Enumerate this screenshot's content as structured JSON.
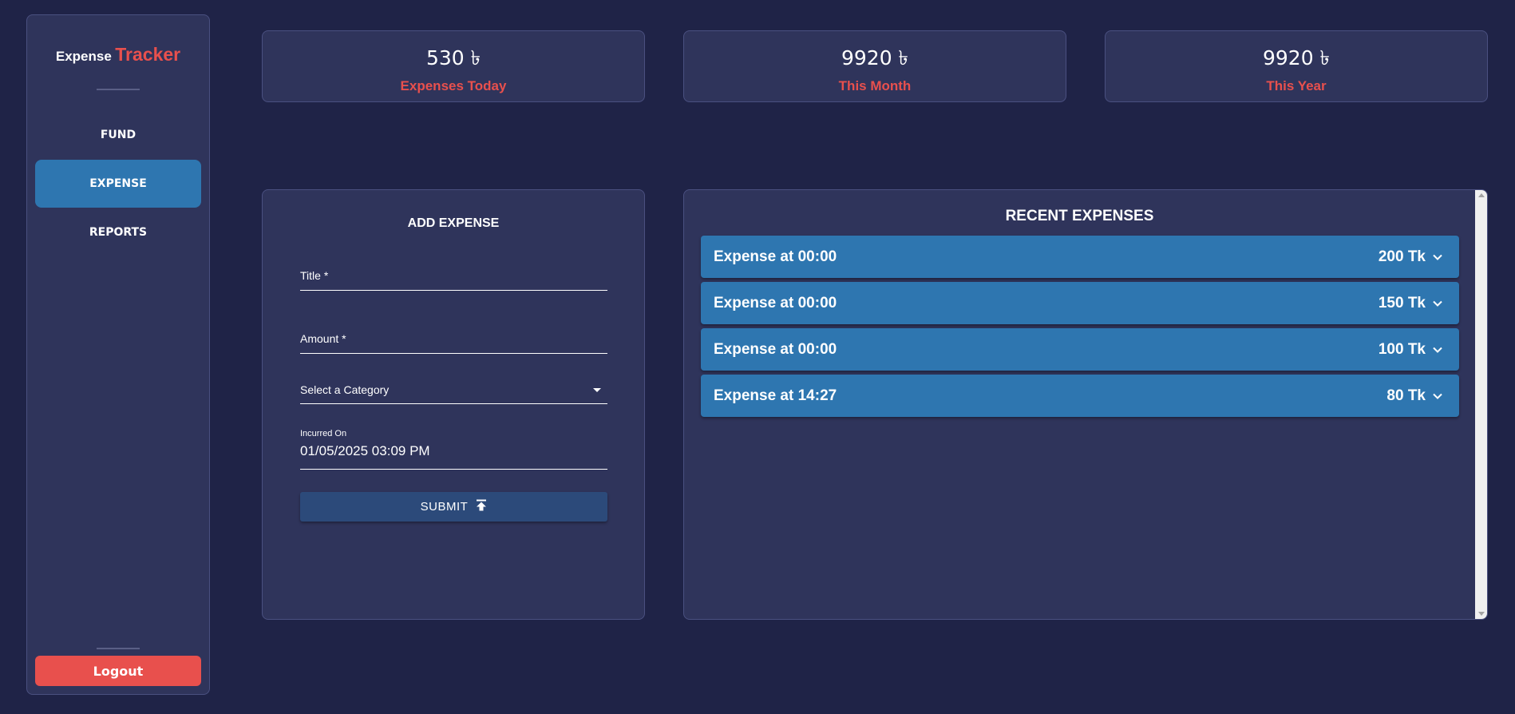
{
  "sidebar": {
    "brand_part1": "Expense",
    "brand_part2": "Tracker",
    "items": [
      {
        "label": "FUND"
      },
      {
        "label": "EXPENSE"
      },
      {
        "label": "REPORTS"
      }
    ],
    "active_item": "EXPENSE",
    "logout_label": "Logout"
  },
  "stats": [
    {
      "value": "530 ৳",
      "label": "Expenses Today"
    },
    {
      "value": "9920 ৳",
      "label": "This Month"
    },
    {
      "value": "9920 ৳",
      "label": "This Year"
    }
  ],
  "add_expense": {
    "title": "ADD EXPENSE",
    "title_label": "Title *",
    "amount_label": "Amount *",
    "category_placeholder": "Select a Category",
    "incurred_label": "Incurred On",
    "incurred_value": "01/05/2025 03:09 PM",
    "submit_label": "SUBMIT"
  },
  "recent": {
    "title": "RECENT EXPENSES",
    "items": [
      {
        "title": "Expense at 00:00",
        "amount": "200 Tk"
      },
      {
        "title": "Expense at 00:00",
        "amount": "150 Tk"
      },
      {
        "title": "Expense at 00:00",
        "amount": "100 Tk"
      },
      {
        "title": "Expense at 14:27",
        "amount": "80 Tk"
      }
    ]
  },
  "colors": {
    "background": "#1f2347",
    "panel": "#2f345b",
    "accent_blue": "#2e76b0",
    "accent_red": "#e8504d",
    "submit": "#2c4a7a"
  },
  "icons": {
    "submit": "upload-icon",
    "expand": "chevron-down-icon",
    "category": "caret-down-icon"
  }
}
